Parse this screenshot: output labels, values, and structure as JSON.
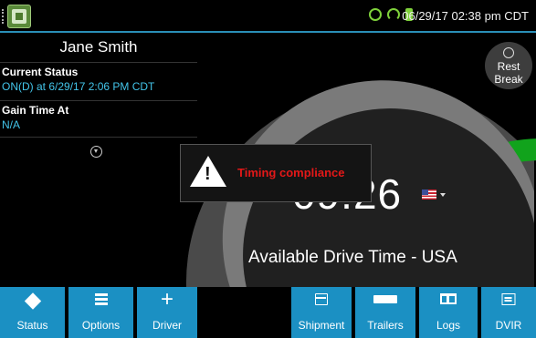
{
  "status_bar": {
    "datetime": "06/29/17 02:38 pm CDT",
    "icons": [
      "gps-icon",
      "wifi-icon",
      "power-plug-icon"
    ],
    "accent_color": "#7fd13b"
  },
  "driver": {
    "name": "Jane Smith",
    "current_status_label": "Current Status",
    "current_status_value": "ON(D) at 6/29/17 2:06 PM CDT",
    "gain_time_label": "Gain Time At",
    "gain_time_value": "N/A"
  },
  "gauge": {
    "time": "09:26",
    "label": "Available Drive Time - USA",
    "country_flag": "us-flag-icon",
    "arc_color": "#11a31c",
    "remaining_fraction": 0.85
  },
  "rest_break": {
    "label_line1": "Rest",
    "label_line2": "Break"
  },
  "toast": {
    "message": "Timing compliance",
    "message_color": "#e31818"
  },
  "bottom_bar": {
    "accent_color": "#1b90c3",
    "buttons": [
      {
        "label": "Status",
        "icon": "status-icon"
      },
      {
        "label": "Options",
        "icon": "options-icon"
      },
      {
        "label": "Driver",
        "icon": "plus-icon"
      },
      {
        "label": "Shipment",
        "icon": "shipment-icon"
      },
      {
        "label": "Trailers",
        "icon": "trailer-icon"
      },
      {
        "label": "Logs",
        "icon": "logs-icon"
      },
      {
        "label": "DVIR",
        "icon": "dvir-icon"
      }
    ]
  }
}
